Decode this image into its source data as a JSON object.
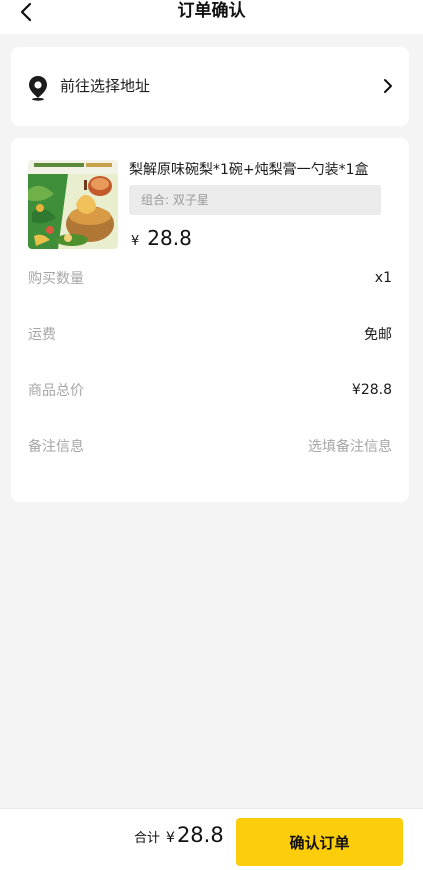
{
  "header": {
    "title": "订单确认",
    "back_icon": "chevron-left-icon"
  },
  "address": {
    "label": "前往选择地址",
    "icon": "location-pin-icon",
    "chevron": "chevron-right-icon"
  },
  "product": {
    "name": "梨解原味碗梨*1碗+炖梨膏一勺装*1盒",
    "variant": "组合: 双子星",
    "currency": "¥",
    "price": "28.8"
  },
  "order_rows": [
    {
      "label": "购买数量",
      "value": "x1"
    },
    {
      "label": "运费",
      "value": "免邮"
    },
    {
      "label": "商品总价",
      "value": "¥28.8"
    },
    {
      "label": "备注信息",
      "value": "选填备注信息"
    }
  ],
  "footer": {
    "total_label": "合计",
    "currency": "¥",
    "total": "28.8",
    "confirm_label": "确认订单"
  },
  "colors": {
    "accent": "#fbcd0a",
    "background": "#f4f4f4"
  }
}
